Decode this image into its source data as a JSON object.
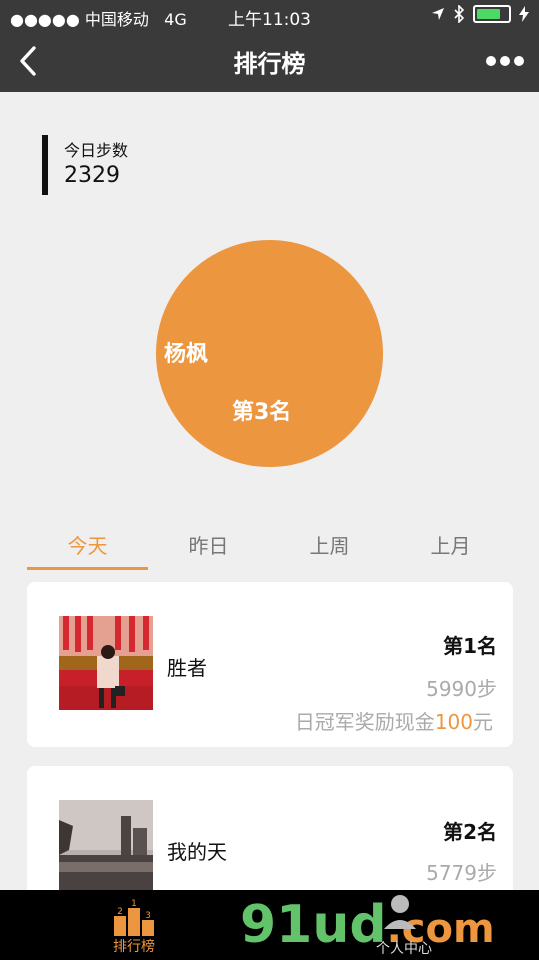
{
  "status": {
    "carrier": "●●●●● 中国移动",
    "network": "4G",
    "time": "上午11:03"
  },
  "nav": {
    "title": "排行榜"
  },
  "today_steps": {
    "label": "今日步数",
    "value": "2329"
  },
  "me": {
    "name": "杨枫",
    "rank": "第3名"
  },
  "tabs": [
    {
      "label": "今天",
      "active": true
    },
    {
      "label": "昨日",
      "active": false
    },
    {
      "label": "上周",
      "active": false
    },
    {
      "label": "上月",
      "active": false
    }
  ],
  "leaderboard": [
    {
      "name": "胜者",
      "rank": "第1名",
      "steps": "5990步",
      "reward_prefix": "日冠军奖励现金",
      "reward_amount": "100",
      "reward_suffix": "元"
    },
    {
      "name": "我的天",
      "rank": "第2名",
      "steps": "5779步"
    }
  ],
  "bottom": {
    "tab_label": "排行榜",
    "second_label": "个人中心"
  },
  "watermark": {
    "main": "91ud",
    "suffix": ".com"
  },
  "colors": {
    "accent": "#ec9640",
    "navbar": "#3a3a3a",
    "background": "#efefef"
  }
}
